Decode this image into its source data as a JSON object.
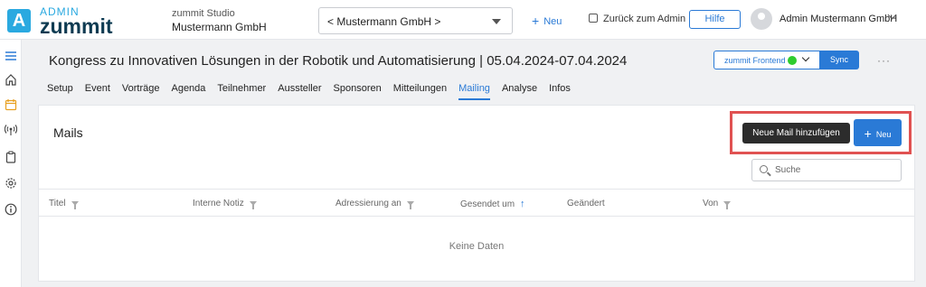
{
  "brand": {
    "admin_label": "ADMIN",
    "name": "zummit",
    "mark": "A"
  },
  "studio": {
    "label": "zummit Studio",
    "org": "Mustermann GmbH"
  },
  "org_select": {
    "value": "< Mustermann GmbH >"
  },
  "topbar": {
    "new_label": "Neu",
    "back_label": "Zurück zum Admin",
    "help_label": "Hilfe",
    "user_name": "Admin Mustermann GmbH"
  },
  "event": {
    "title": "Kongress zu Innovativen Lösungen in der Robotik und Automatisierung | 05.04.2024-07.04.2024",
    "frontend_label": "zummit Frontend",
    "frontend_status_color": "#2ecc2e",
    "sync_label": "Sync",
    "more_label": "···"
  },
  "tabs": [
    {
      "label": "Setup"
    },
    {
      "label": "Event"
    },
    {
      "label": "Vorträge"
    },
    {
      "label": "Agenda"
    },
    {
      "label": "Teilnehmer"
    },
    {
      "label": "Aussteller"
    },
    {
      "label": "Sponsoren"
    },
    {
      "label": "Mitteilungen"
    },
    {
      "label": "Mailing",
      "active": true
    },
    {
      "label": "Analyse"
    },
    {
      "label": "Infos"
    }
  ],
  "mails": {
    "title": "Mails",
    "tooltip": "Neue Mail hinzufügen",
    "new_button": "Neu",
    "search_placeholder": "Suche",
    "columns": [
      {
        "label": "Titel",
        "control": "filter"
      },
      {
        "label": "Interne Notiz",
        "control": "filter"
      },
      {
        "label": "Adressierung an",
        "control": "filter"
      },
      {
        "label": "Gesendet um",
        "control": "sort"
      },
      {
        "label": "Geändert",
        "control": "none"
      },
      {
        "label": "Von",
        "control": "filter"
      }
    ],
    "empty_text": "Keine Daten"
  },
  "colors": {
    "accent": "#2a7ad6",
    "brand": "#2aa9e0",
    "highlight": "#e05252"
  },
  "sidenav_icons": [
    "menu-icon",
    "home-icon",
    "calendar-icon",
    "broadcast-icon",
    "clipboard-icon",
    "settings-icon",
    "info-icon"
  ]
}
